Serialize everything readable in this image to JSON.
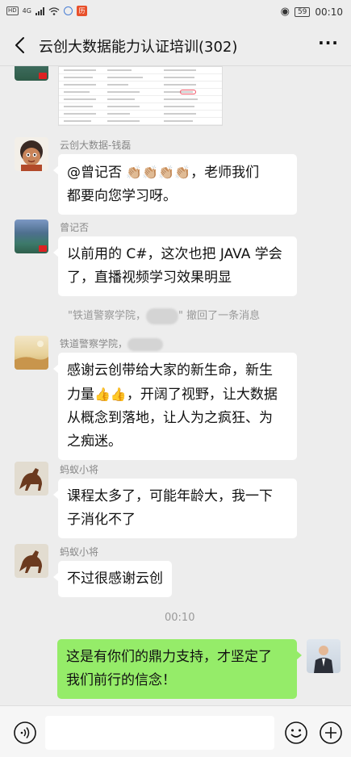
{
  "status_bar": {
    "left_chip": "HD",
    "network": "4G",
    "app_badge": "历",
    "battery": "59",
    "time": "00:10"
  },
  "header": {
    "title": "云创大数据能力认证培训(302)",
    "more": "···"
  },
  "messages": [
    {
      "sender": "云创大数据-钱磊",
      "text_before": "@曾记否 ",
      "emoji": "👏🏼👏🏼👏🏼👏🏼",
      "text_after": "，老师我们都要向您学习呀。",
      "line1": "@曾记否 ",
      "line1b": "，老师我们",
      "line2": "都要向您学习呀。"
    },
    {
      "sender": "曾记否",
      "line1": "以前用的 C#，这次也把 JAVA 学会",
      "line2": "了，直播视频学习效果明显"
    },
    {
      "system_prefix": "\"铁道警察学院，",
      "system_suffix": "\" 撤回了一条消息"
    },
    {
      "sender": "铁道警察学院，",
      "line1": "感谢云创带给大家的新生命，新生",
      "line2a": "力量",
      "line2_emoji": "👍👍",
      "line2b": "，开阔了视野，让大数据",
      "line3": "从概念到落地，让人为之疯狂、为",
      "line4": "之痴迷。"
    },
    {
      "sender": "蚂蚁小将",
      "line1": "课程太多了，可能年龄大，我一下",
      "line2": "子消化不了"
    },
    {
      "sender": "蚂蚁小将",
      "line1": "不过很感谢云创"
    },
    {
      "timestamp": "00:10"
    },
    {
      "line1": "这是有你们的鼎力支持，才坚定了",
      "line2": "我们前行的信念！"
    }
  ],
  "colors": {
    "background": "#ededed",
    "own_bubble": "#95ec69",
    "other_bubble": "#ffffff"
  }
}
